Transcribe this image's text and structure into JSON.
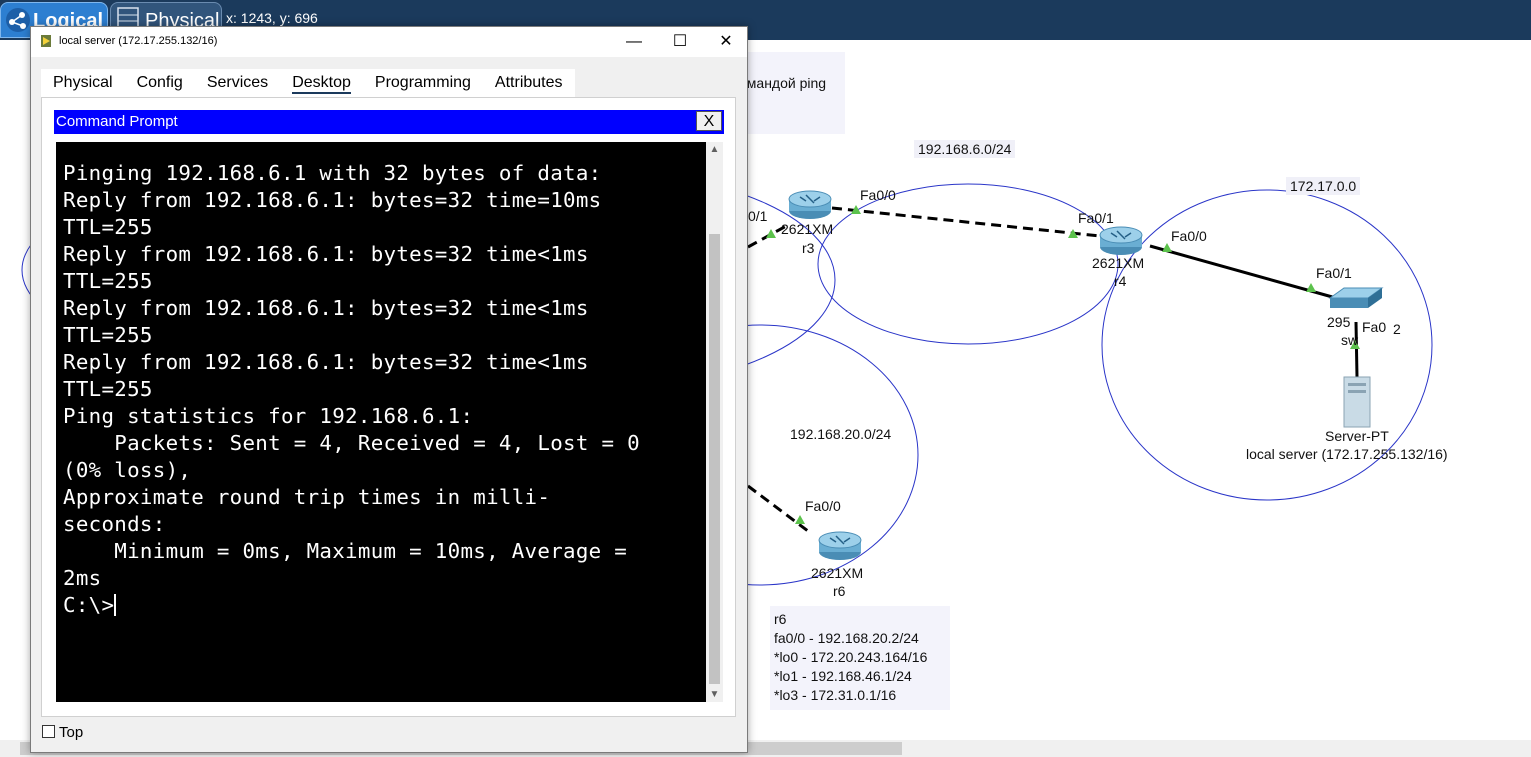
{
  "app": {
    "tabs": [
      {
        "label": "Logical",
        "active": true,
        "icon": "network-icon"
      },
      {
        "label": "Physical",
        "active": false,
        "icon": "rack-icon"
      }
    ],
    "coords": "x: 1243, y: 696"
  },
  "canvas": {
    "background_note": "омандой ping",
    "networks": [
      "192.168.6.0/24",
      "172.17.0.0",
      "192.168.20.0/24"
    ],
    "ports": [
      "0/1",
      "Fa0/0",
      "Fa0/1",
      "Fa0/0",
      "Fa0/1",
      "Fa0",
      "2",
      "Fa0/0"
    ],
    "devices": [
      {
        "model": "2621XM",
        "name": "r3"
      },
      {
        "model": "2621XM",
        "name": "r4"
      },
      {
        "model": "295",
        "name": "sw"
      },
      {
        "model": "Server-PT",
        "name": "local server (172.17.255.132/16)"
      },
      {
        "model": "2621XM",
        "name": "r6"
      }
    ],
    "r6_note": [
      "r6",
      "fa0/0 - 192.168.20.2/24",
      "*lo0 - 172.20.243.164/16",
      "*lo1 - 192.168.46.1/24",
      "*lo3 - 172.31.0.1/16"
    ],
    "link_color": "#000000",
    "circle_color": "#2a35c8",
    "port_marker_color": "#5cc24c"
  },
  "window": {
    "title": "local server (172.17.255.132/16)",
    "controls": {
      "minimize": "—",
      "maximize": "☐",
      "close": "✕"
    },
    "tabs": [
      "Physical",
      "Config",
      "Services",
      "Desktop",
      "Programming",
      "Attributes"
    ],
    "active_tab": "Desktop",
    "command_prompt": {
      "title": "Command Prompt",
      "close_label": "X",
      "lines": [
        "Pinging 192.168.6.1 with 32 bytes of data:",
        "",
        "Reply from 192.168.6.1: bytes=32 time=10ms",
        "TTL=255",
        "Reply from 192.168.6.1: bytes=32 time<1ms",
        "TTL=255",
        "Reply from 192.168.6.1: bytes=32 time<1ms",
        "TTL=255",
        "Reply from 192.168.6.1: bytes=32 time<1ms",
        "TTL=255",
        "",
        "Ping statistics for 192.168.6.1:",
        "    Packets: Sent = 4, Received = 4, Lost = 0",
        "(0% loss),",
        "Approximate round trip times in milli-",
        "seconds:",
        "    Minimum = 0ms, Maximum = 10ms, Average =",
        "2ms",
        "",
        "C:\\>"
      ]
    },
    "top_checkbox": {
      "label": "Top",
      "checked": false
    }
  }
}
